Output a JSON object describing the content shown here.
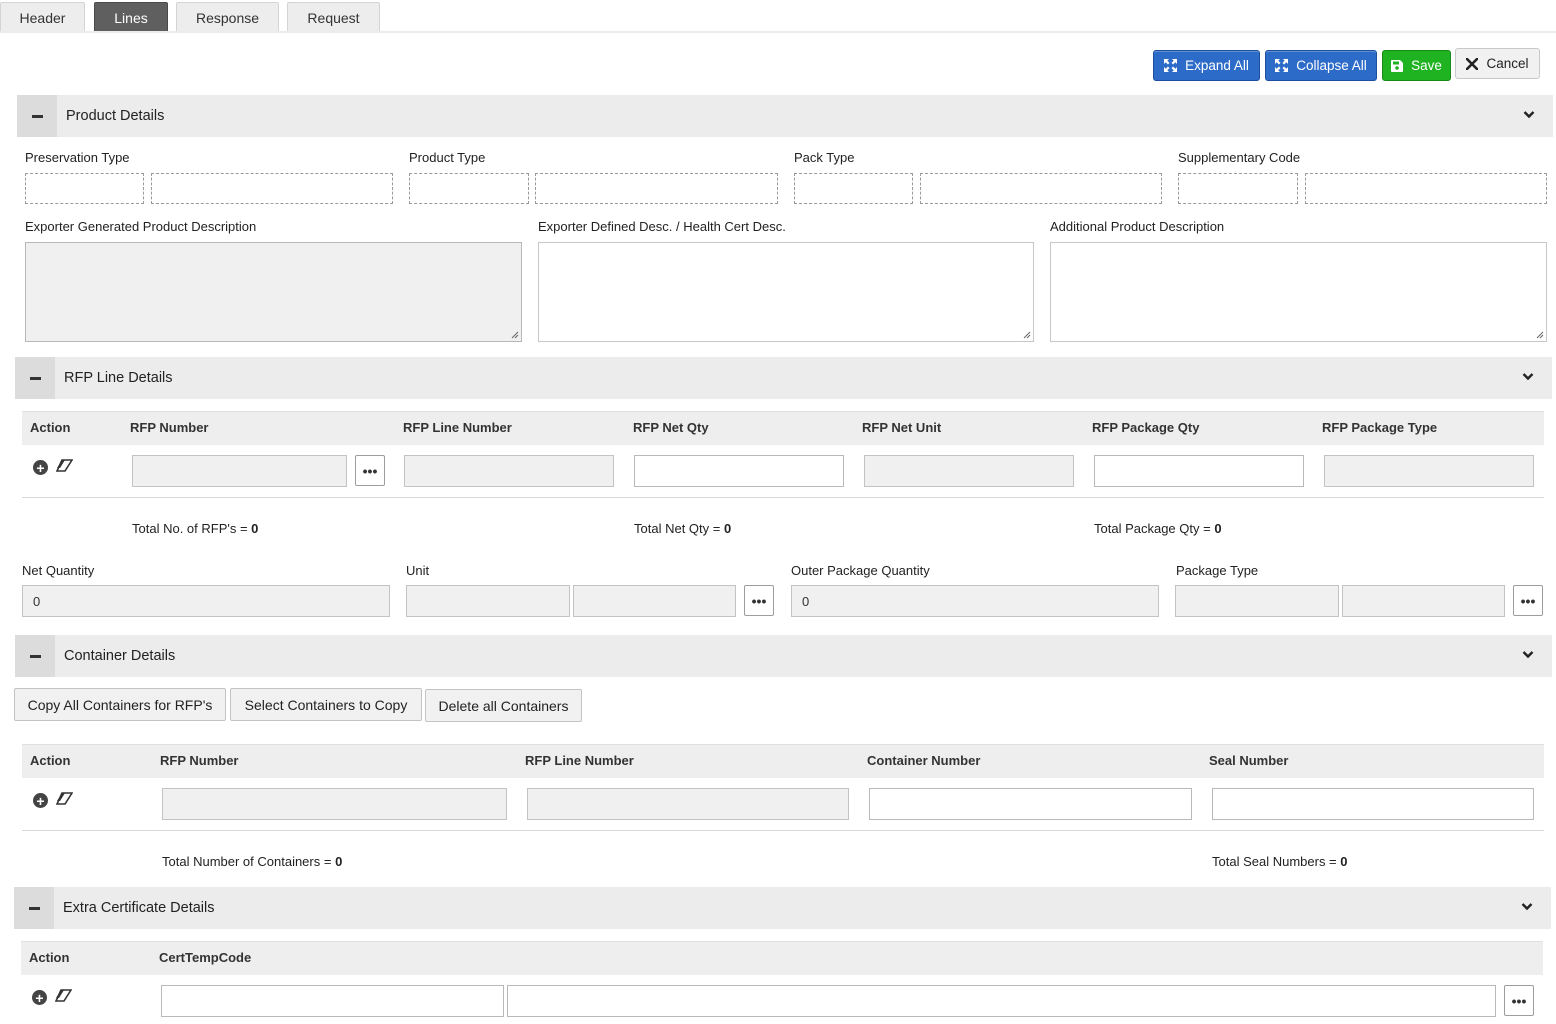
{
  "tabs": [
    {
      "label": "Header"
    },
    {
      "label": "Lines"
    },
    {
      "label": "Response"
    },
    {
      "label": "Request"
    }
  ],
  "toolbar": {
    "expand_all": "Expand All",
    "collapse_all": "Collapse All",
    "save": "Save",
    "cancel": "Cancel"
  },
  "colors": {
    "active_tab": "#5f5f5f",
    "primary_blue": "#2d6bc9",
    "save_green": "#1fb321",
    "section_bg": "#ececec"
  },
  "product_details": {
    "title": "Product Details",
    "fields": {
      "preservation_type": "Preservation Type",
      "product_type": "Product Type",
      "pack_type": "Pack Type",
      "supplementary_code": "Supplementary Code",
      "exporter_generated_desc": "Exporter Generated Product Description",
      "exporter_defined_desc": "Exporter Defined Desc. / Health Cert Desc.",
      "additional_desc": "Additional Product Description"
    }
  },
  "rfp_line_details": {
    "title": "RFP Line Details",
    "columns": [
      "Action",
      "RFP Number",
      "RFP Line Number",
      "RFP Net Qty",
      "RFP Net Unit",
      "RFP Package Qty",
      "RFP Package Type"
    ],
    "totals": {
      "rfps_label": "Total No. of RFP's = ",
      "rfps_value": "0",
      "net_qty_label": "Total Net Qty = ",
      "net_qty_value": "0",
      "package_qty_label": "Total Package Qty = ",
      "package_qty_value": "0"
    },
    "net_quantity_label": "Net Quantity",
    "net_quantity_value": "0",
    "unit_label": "Unit",
    "outer_package_quantity_label": "Outer Package Quantity",
    "outer_package_quantity_value": "0",
    "package_type_label": "Package Type"
  },
  "container_details": {
    "title": "Container Details",
    "buttons": {
      "copy_all": "Copy All Containers for RFP's",
      "select_copy": "Select Containers to Copy",
      "delete_all": "Delete all Containers"
    },
    "columns": [
      "Action",
      "RFP Number",
      "RFP Line Number",
      "Container Number",
      "Seal Number"
    ],
    "totals": {
      "containers_label": "Total Number of Containers = ",
      "containers_value": "0",
      "seals_label": "Total Seal Numbers = ",
      "seals_value": "0"
    }
  },
  "extra_certificate_details": {
    "title": "Extra Certificate Details",
    "columns": [
      "Action",
      "CertTempCode"
    ]
  },
  "icons": {
    "toggle": "minus-icon",
    "chevron": "chevron-down-icon",
    "add": "plus-circle-icon",
    "remove": "eraser-icon",
    "lookup": "ellipsis-icon",
    "expand": "expand-icon",
    "collapse": "collapse-icon",
    "save": "floppy-icon",
    "cancel": "close-icon"
  }
}
